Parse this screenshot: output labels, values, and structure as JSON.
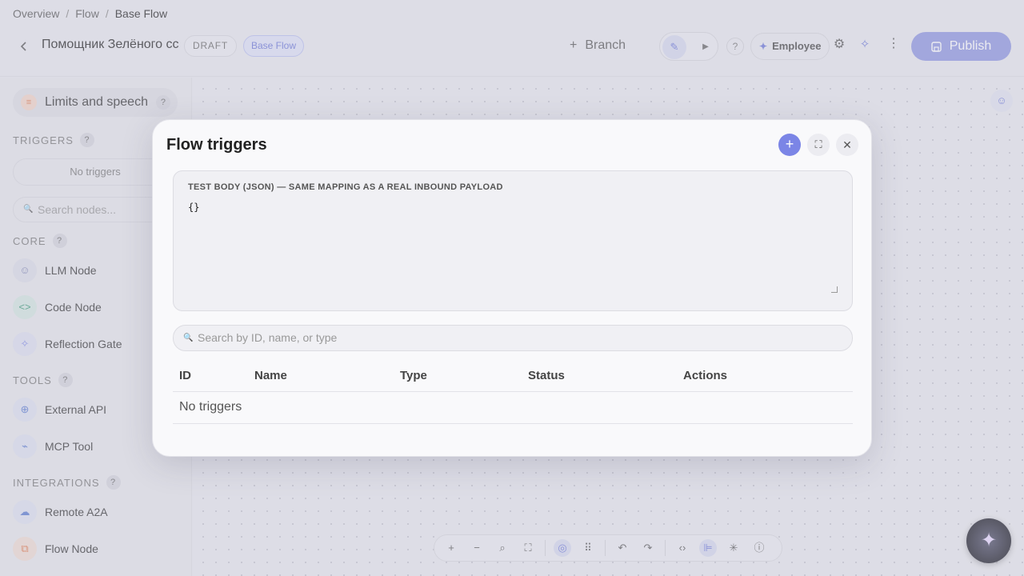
{
  "breadcrumb": {
    "items": [
      "Overview",
      "Flow",
      "Base Flow"
    ],
    "separator": "/"
  },
  "header": {
    "flow_name": "Помощник Зелёного сс",
    "status_badge": "DRAFT",
    "flow_badge": "Base Flow",
    "branch_icon": "+",
    "branch_label": "Branch",
    "help": "?",
    "employee_label": "Employee",
    "publish_label": "Publish"
  },
  "sidebar": {
    "limits_label": "Limits and speech",
    "help": "?",
    "triggers_heading": "TRIGGERS",
    "no_triggers": "No triggers",
    "search_placeholder": "Search nodes...",
    "sections": {
      "core": "CORE",
      "tools": "TOOLS",
      "integrations": "INTEGRATIONS"
    },
    "nodes": {
      "llm": "LLM Node",
      "code": "Code Node",
      "reflection": "Reflection Gate",
      "external_api": "External API",
      "mcp_tool": "MCP Tool",
      "remote_a2a": "Remote A2A",
      "flow_node": "Flow Node"
    }
  },
  "modal": {
    "title": "Flow triggers",
    "body_label": "TEST BODY (JSON) — SAME MAPPING AS A REAL INBOUND PAYLOAD",
    "body_value": "{}",
    "search_placeholder": "Search by ID, name, or type",
    "columns": [
      "ID",
      "Name",
      "Type",
      "Status",
      "Actions"
    ],
    "empty_text": "No triggers"
  },
  "colors": {
    "accent": "#7b85e6",
    "publish": "#8e96e0",
    "background": "#e9e9ee"
  }
}
